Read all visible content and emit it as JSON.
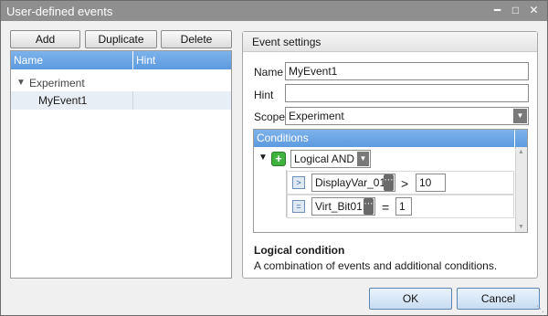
{
  "window": {
    "title": "User-defined events",
    "minimize_icon": "minimize-icon",
    "maximize_icon": "maximize-icon",
    "close_icon": "close-icon"
  },
  "toolbar": {
    "add_label": "Add",
    "duplicate_label": "Duplicate",
    "delete_label": "Delete"
  },
  "events_list": {
    "columns": [
      "Name",
      "Hint"
    ],
    "group": {
      "label": "Experiment",
      "expanded": true
    },
    "items": [
      {
        "name": "MyEvent1",
        "hint": "",
        "selected": true
      }
    ]
  },
  "settings": {
    "header": "Event settings",
    "name_label": "Name",
    "name_value": "MyEvent1",
    "hint_label": "Hint",
    "hint_value": "",
    "scope_label": "Scope",
    "scope_value": "Experiment",
    "conditions": {
      "header": "Conditions",
      "root_operator": "Logical AND",
      "rows": [
        {
          "variable": "DisplayVar_01",
          "operator": ">",
          "value": "10",
          "type_icon": "greater-than-icon"
        },
        {
          "variable": "Virt_Bit01",
          "operator": "=",
          "value": "1",
          "type_icon": "equals-icon"
        }
      ]
    },
    "description": {
      "title": "Logical condition",
      "text": "A combination of events and additional conditions."
    }
  },
  "footer": {
    "ok_label": "OK",
    "cancel_label": "Cancel"
  },
  "colors": {
    "header_blue": "#5c9ae0",
    "selection": "#e8eef6",
    "add_green": "#2f9e2f"
  }
}
